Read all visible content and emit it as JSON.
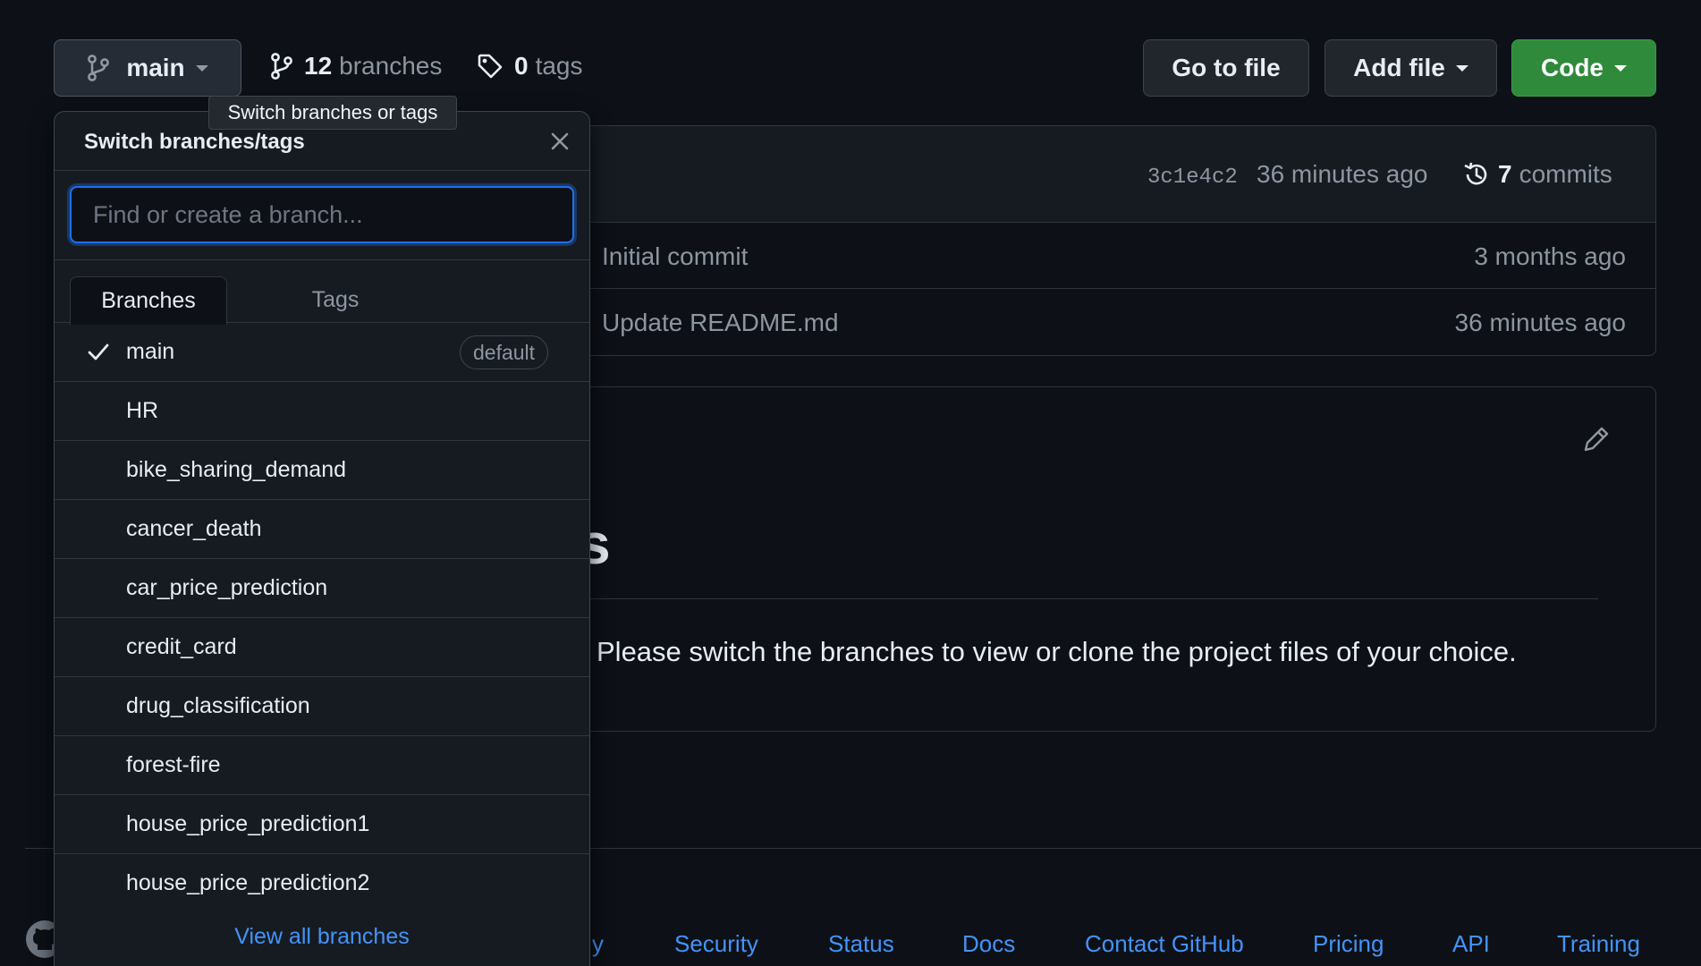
{
  "toolbar": {
    "branch_button_label": "main",
    "branches_count": "12",
    "branches_label": "branches",
    "tags_count": "0",
    "tags_label": "tags",
    "go_to_file_label": "Go to file",
    "add_file_label": "Add file",
    "code_label": "Code"
  },
  "tooltip": {
    "text": "Switch branches or tags"
  },
  "repo": {
    "commit_hash": "3c1e4c2",
    "commit_time": "36 minutes ago",
    "commits_count": "7",
    "commits_label": "commits",
    "files": [
      {
        "message": "Initial commit",
        "time": "3 months ago"
      },
      {
        "message": "Update README.md",
        "time": "36 minutes ago"
      }
    ]
  },
  "readme": {
    "heading_fragment": "s",
    "body_text": "Please switch the branches to view or clone the project files of your choice."
  },
  "dropdown": {
    "title": "Switch branches/tags",
    "search_placeholder": "Find or create a branch...",
    "tabs": [
      "Branches",
      "Tags"
    ],
    "active_tab": "Branches",
    "default_badge": "default",
    "branches": [
      "main",
      "HR",
      "bike_sharing_demand",
      "cancer_death",
      "car_price_prediction",
      "credit_card",
      "drug_classification",
      "forest-fire",
      "house_price_prediction1",
      "house_price_prediction2"
    ],
    "selected_branch": "main",
    "view_all_label": "View all branches"
  },
  "footer": {
    "links": [
      "y",
      "Security",
      "Status",
      "Docs",
      "Contact GitHub",
      "Pricing",
      "API",
      "Training"
    ]
  },
  "colors": {
    "background": "#0d1117",
    "accent_blue": "#4493f8",
    "code_green": "#2f8a3c",
    "muted_text": "#8d96a0"
  }
}
